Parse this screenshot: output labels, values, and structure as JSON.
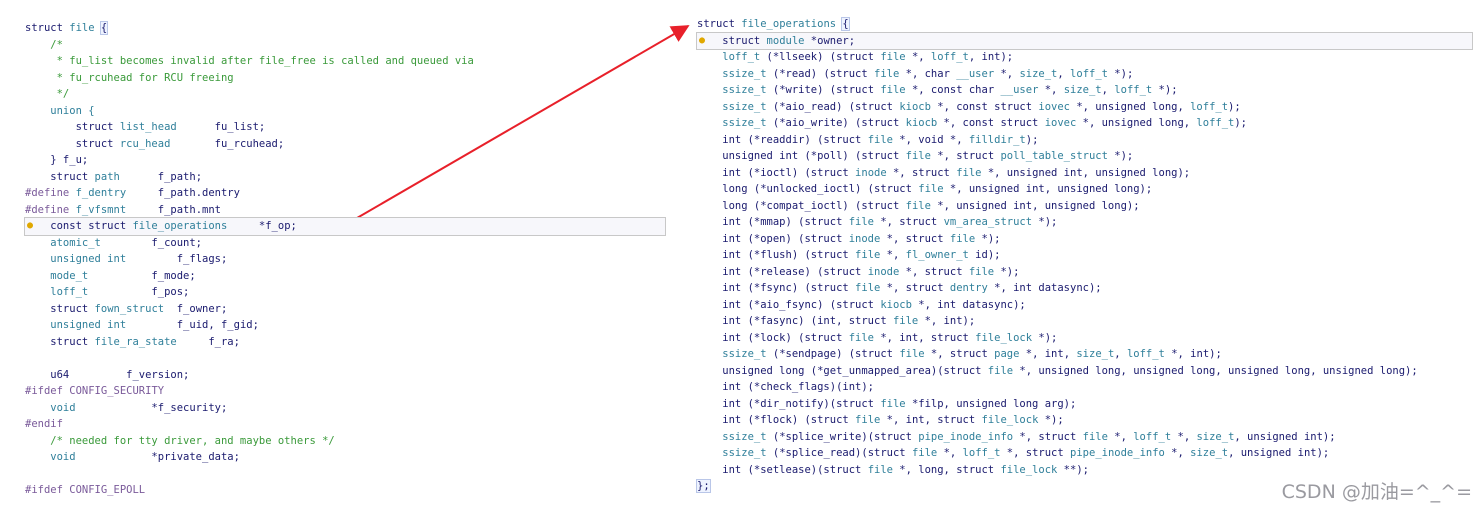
{
  "left_code": [
    [
      {
        "t": "struct ",
        "c": "kw"
      },
      {
        "t": "file",
        "c": "type"
      },
      {
        "t": " "
      },
      {
        "t": "{",
        "c": "brace"
      }
    ],
    [
      {
        "t": "    /*",
        "c": "comment"
      }
    ],
    [
      {
        "t": "     * fu_list becomes invalid after file_free is called and queued via",
        "c": "comment"
      }
    ],
    [
      {
        "t": "     * fu_rcuhead for RCU freeing",
        "c": "comment"
      }
    ],
    [
      {
        "t": "     */",
        "c": "comment"
      }
    ],
    [
      {
        "t": "    union {",
        "c": "type"
      }
    ],
    [
      {
        "t": "        struct "
      },
      {
        "t": "list_head",
        "c": "type"
      },
      {
        "t": "      fu_list;"
      }
    ],
    [
      {
        "t": "        struct "
      },
      {
        "t": "rcu_head",
        "c": "type"
      },
      {
        "t": "       fu_rcuhead;"
      }
    ],
    [
      {
        "t": "    } f_u;"
      }
    ],
    [
      {
        "t": "    struct "
      },
      {
        "t": "path",
        "c": "type"
      },
      {
        "t": "      f_path;"
      }
    ],
    [
      {
        "t": "#define ",
        "c": "pre"
      },
      {
        "t": "f_dentry",
        "c": "type"
      },
      {
        "t": "     f_path.dentry"
      }
    ],
    [
      {
        "t": "#define ",
        "c": "pre"
      },
      {
        "t": "f_vfsmnt",
        "c": "type"
      },
      {
        "t": "     f_path.mnt"
      }
    ],
    [
      {
        "t": "    const struct "
      },
      {
        "t": "file_operations",
        "c": "type"
      },
      {
        "t": "     *f_op;"
      }
    ],
    [
      {
        "t": "    atomic_t",
        "c": "type"
      },
      {
        "t": "        f_count;"
      }
    ],
    [
      {
        "t": "    unsigned int",
        "c": "type"
      },
      {
        "t": "        f_flags;"
      }
    ],
    [
      {
        "t": "    mode_t",
        "c": "type"
      },
      {
        "t": "          f_mode;"
      }
    ],
    [
      {
        "t": "    loff_t",
        "c": "type"
      },
      {
        "t": "          f_pos;"
      }
    ],
    [
      {
        "t": "    struct "
      },
      {
        "t": "fown_struct",
        "c": "type"
      },
      {
        "t": "  f_owner;"
      }
    ],
    [
      {
        "t": "    unsigned int",
        "c": "type"
      },
      {
        "t": "        f_uid, f_gid;"
      }
    ],
    [
      {
        "t": "    struct "
      },
      {
        "t": "file_ra_state",
        "c": "type"
      },
      {
        "t": "     f_ra;"
      }
    ],
    [
      {
        "t": ""
      }
    ],
    [
      {
        "t": "    u64         f_version;"
      }
    ],
    [
      {
        "t": "#ifdef ",
        "c": "pre"
      },
      {
        "t": "CONFIG_SECURITY",
        "c": "pre"
      }
    ],
    [
      {
        "t": "    void",
        "c": "type"
      },
      {
        "t": "            *f_security;"
      }
    ],
    [
      {
        "t": "#endif",
        "c": "pre"
      }
    ],
    [
      {
        "t": "    /* needed for tty driver, and maybe others */",
        "c": "comment"
      }
    ],
    [
      {
        "t": "    void",
        "c": "type"
      },
      {
        "t": "            *private_data;"
      }
    ],
    [
      {
        "t": ""
      }
    ],
    [
      {
        "t": "#ifdef CONFIG_EPOLL",
        "c": "pre"
      }
    ]
  ],
  "right_code": [
    [
      {
        "t": "struct "
      },
      {
        "t": "file_operations",
        "c": "type"
      },
      {
        "t": " "
      },
      {
        "t": "{",
        "c": "brace"
      }
    ],
    [
      {
        "t": "    struct "
      },
      {
        "t": "module",
        "c": "type"
      },
      {
        "t": " *owner;"
      }
    ],
    [
      {
        "t": "    loff_t",
        "c": "type"
      },
      {
        "t": " (*llseek) (struct "
      },
      {
        "t": "file",
        "c": "type"
      },
      {
        "t": " *, "
      },
      {
        "t": "loff_t",
        "c": "type"
      },
      {
        "t": ", int);"
      }
    ],
    [
      {
        "t": "    ssize_t",
        "c": "type"
      },
      {
        "t": " (*read) (struct "
      },
      {
        "t": "file",
        "c": "type"
      },
      {
        "t": " *, char "
      },
      {
        "t": "__user",
        "c": "type"
      },
      {
        "t": " *, "
      },
      {
        "t": "size_t",
        "c": "type"
      },
      {
        "t": ", "
      },
      {
        "t": "loff_t",
        "c": "type"
      },
      {
        "t": " *);"
      }
    ],
    [
      {
        "t": "    ssize_t",
        "c": "type"
      },
      {
        "t": " (*write) (struct "
      },
      {
        "t": "file",
        "c": "type"
      },
      {
        "t": " *, const char "
      },
      {
        "t": "__user",
        "c": "type"
      },
      {
        "t": " *, "
      },
      {
        "t": "size_t",
        "c": "type"
      },
      {
        "t": ", "
      },
      {
        "t": "loff_t",
        "c": "type"
      },
      {
        "t": " *);"
      }
    ],
    [
      {
        "t": "    ssize_t",
        "c": "type"
      },
      {
        "t": " (*aio_read) (struct "
      },
      {
        "t": "kiocb",
        "c": "type"
      },
      {
        "t": " *, const struct "
      },
      {
        "t": "iovec",
        "c": "type"
      },
      {
        "t": " *, unsigned long, "
      },
      {
        "t": "loff_t",
        "c": "type"
      },
      {
        "t": ");"
      }
    ],
    [
      {
        "t": "    ssize_t",
        "c": "type"
      },
      {
        "t": " (*aio_write) (struct "
      },
      {
        "t": "kiocb",
        "c": "type"
      },
      {
        "t": " *, const struct "
      },
      {
        "t": "iovec",
        "c": "type"
      },
      {
        "t": " *, unsigned long, "
      },
      {
        "t": "loff_t",
        "c": "type"
      },
      {
        "t": ");"
      }
    ],
    [
      {
        "t": "    int (*readdir) (struct "
      },
      {
        "t": "file",
        "c": "type"
      },
      {
        "t": " *, void *, "
      },
      {
        "t": "filldir_t",
        "c": "type"
      },
      {
        "t": ");"
      }
    ],
    [
      {
        "t": "    unsigned int (*poll) (struct "
      },
      {
        "t": "file",
        "c": "type"
      },
      {
        "t": " *, struct "
      },
      {
        "t": "poll_table_struct",
        "c": "type"
      },
      {
        "t": " *);"
      }
    ],
    [
      {
        "t": "    int (*ioctl) (struct "
      },
      {
        "t": "inode",
        "c": "type"
      },
      {
        "t": " *, struct "
      },
      {
        "t": "file",
        "c": "type"
      },
      {
        "t": " *, unsigned int, unsigned long);"
      }
    ],
    [
      {
        "t": "    long (*unlocked_ioctl) (struct "
      },
      {
        "t": "file",
        "c": "type"
      },
      {
        "t": " *, unsigned int, unsigned long);"
      }
    ],
    [
      {
        "t": "    long (*compat_ioctl) (struct "
      },
      {
        "t": "file",
        "c": "type"
      },
      {
        "t": " *, unsigned int, unsigned long);"
      }
    ],
    [
      {
        "t": "    int (*mmap) (struct "
      },
      {
        "t": "file",
        "c": "type"
      },
      {
        "t": " *, struct "
      },
      {
        "t": "vm_area_struct",
        "c": "type"
      },
      {
        "t": " *);"
      }
    ],
    [
      {
        "t": "    int (*open) (struct "
      },
      {
        "t": "inode",
        "c": "type"
      },
      {
        "t": " *, struct "
      },
      {
        "t": "file",
        "c": "type"
      },
      {
        "t": " *);"
      }
    ],
    [
      {
        "t": "    int (*flush) (struct "
      },
      {
        "t": "file",
        "c": "type"
      },
      {
        "t": " *, "
      },
      {
        "t": "fl_owner_t",
        "c": "type"
      },
      {
        "t": " id);"
      }
    ],
    [
      {
        "t": "    int (*release) (struct "
      },
      {
        "t": "inode",
        "c": "type"
      },
      {
        "t": " *, struct "
      },
      {
        "t": "file",
        "c": "type"
      },
      {
        "t": " *);"
      }
    ],
    [
      {
        "t": "    int (*fsync) (struct "
      },
      {
        "t": "file",
        "c": "type"
      },
      {
        "t": " *, struct "
      },
      {
        "t": "dentry",
        "c": "type"
      },
      {
        "t": " *, int datasync);"
      }
    ],
    [
      {
        "t": "    int (*aio_fsync) (struct "
      },
      {
        "t": "kiocb",
        "c": "type"
      },
      {
        "t": " *, int datasync);"
      }
    ],
    [
      {
        "t": "    int (*fasync) (int, struct "
      },
      {
        "t": "file",
        "c": "type"
      },
      {
        "t": " *, int);"
      }
    ],
    [
      {
        "t": "    int (*lock) (struct "
      },
      {
        "t": "file",
        "c": "type"
      },
      {
        "t": " *, int, struct "
      },
      {
        "t": "file_lock",
        "c": "type"
      },
      {
        "t": " *);"
      }
    ],
    [
      {
        "t": "    ssize_t",
        "c": "type"
      },
      {
        "t": " (*sendpage) (struct "
      },
      {
        "t": "file",
        "c": "type"
      },
      {
        "t": " *, struct "
      },
      {
        "t": "page",
        "c": "type"
      },
      {
        "t": " *, int, "
      },
      {
        "t": "size_t",
        "c": "type"
      },
      {
        "t": ", "
      },
      {
        "t": "loff_t",
        "c": "type"
      },
      {
        "t": " *, int);"
      }
    ],
    [
      {
        "t": "    unsigned long (*get_unmapped_area)(struct "
      },
      {
        "t": "file",
        "c": "type"
      },
      {
        "t": " *, unsigned long, unsigned long, unsigned long, unsigned long);"
      }
    ],
    [
      {
        "t": "    int (*check_flags)(int);"
      }
    ],
    [
      {
        "t": "    int (*dir_notify)(struct "
      },
      {
        "t": "file",
        "c": "type"
      },
      {
        "t": " *filp, unsigned long arg);"
      }
    ],
    [
      {
        "t": "    int (*flock) (struct "
      },
      {
        "t": "file",
        "c": "type"
      },
      {
        "t": " *, int, struct "
      },
      {
        "t": "file_lock",
        "c": "type"
      },
      {
        "t": " *);"
      }
    ],
    [
      {
        "t": "    ssize_t",
        "c": "type"
      },
      {
        "t": " (*splice_write)(struct "
      },
      {
        "t": "pipe_inode_info",
        "c": "type"
      },
      {
        "t": " *, struct "
      },
      {
        "t": "file",
        "c": "type"
      },
      {
        "t": " *, "
      },
      {
        "t": "loff_t",
        "c": "type"
      },
      {
        "t": " *, "
      },
      {
        "t": "size_t",
        "c": "type"
      },
      {
        "t": ", unsigned int);"
      }
    ],
    [
      {
        "t": "    ssize_t",
        "c": "type"
      },
      {
        "t": " (*splice_read)(struct "
      },
      {
        "t": "file",
        "c": "type"
      },
      {
        "t": " *, "
      },
      {
        "t": "loff_t",
        "c": "type"
      },
      {
        "t": " *, struct "
      },
      {
        "t": "pipe_inode_info",
        "c": "type"
      },
      {
        "t": " *, "
      },
      {
        "t": "size_t",
        "c": "type"
      },
      {
        "t": ", unsigned int);"
      }
    ],
    [
      {
        "t": "    int (*setlease)(struct "
      },
      {
        "t": "file",
        "c": "type"
      },
      {
        "t": " *, long, struct "
      },
      {
        "t": "file_lock",
        "c": "type"
      },
      {
        "t": " **);"
      }
    ],
    [
      {
        "t": "};",
        "c": "brace"
      }
    ]
  ],
  "watermark": "CSDN @加油=^_^=",
  "colors": {
    "arrow": "#e8202a",
    "type": "#2f7f9a",
    "comment": "#3a9a3a",
    "text": "#1a1a6e"
  }
}
